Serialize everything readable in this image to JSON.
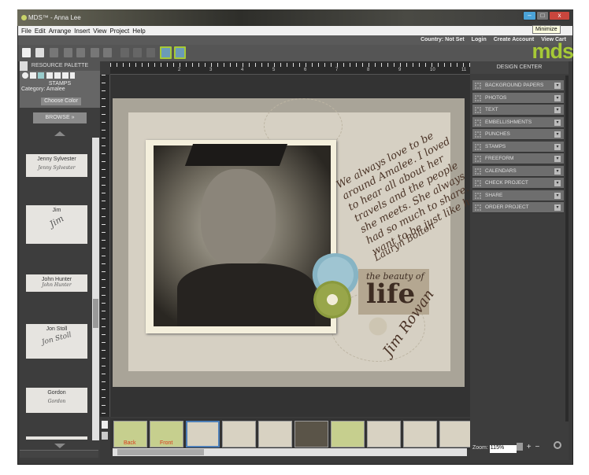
{
  "window": {
    "title": "MDS™ - Anna Lee",
    "tooltip": "Minimize",
    "minimize": "–",
    "maximize": "□",
    "close": "x"
  },
  "menu": [
    "File",
    "Edit",
    "Arrange",
    "Insert",
    "View",
    "Project",
    "Help"
  ],
  "links": [
    "Country: Not Set",
    "Login",
    "Create Account",
    "View Cart"
  ],
  "logo": "mds",
  "left_panel": {
    "title": "RESOURCE PALETTE",
    "section": "STAMPS",
    "category": "Category: Amalee",
    "choose_color": "Choose Color",
    "browse": "BROWSE »",
    "items": [
      {
        "name": "Jenny Sylvester",
        "sig": "Jenny Sylvester"
      },
      {
        "name": "Jim",
        "sig": "Jim"
      },
      {
        "name": "John Hunter",
        "sig": "John Hunter"
      },
      {
        "name": "Jon Stoll",
        "sig": "Jon Stoll"
      },
      {
        "name": "Gordon",
        "sig": "Gordon"
      }
    ]
  },
  "ruler_labels": [
    "2",
    "3",
    "4",
    "5",
    "6",
    "7",
    "8",
    "9",
    "10",
    "11"
  ],
  "page": {
    "journal": "We always love to be around Amalee. I loved to hear all about her travels and the people she meets. She always had so much to share. I want to be just like her.",
    "journal_signature": "Lauryn Bolton",
    "title_small": "the beauty of",
    "title_big": "life",
    "signature": "Jim Rowan"
  },
  "filmstrip": {
    "thumbs": [
      {
        "label": "Back",
        "color": "#c6cf8e"
      },
      {
        "label": "Front",
        "color": "#c6cf8e"
      },
      {
        "label": "",
        "color": "#d8d2c2",
        "selected": true
      },
      {
        "label": "",
        "color": "#d8d2c2"
      },
      {
        "label": "",
        "color": "#d8d2c2"
      },
      {
        "label": "",
        "color": "#5a5448"
      },
      {
        "label": "",
        "color": "#c6cf8e"
      },
      {
        "label": "",
        "color": "#d8d2c2"
      },
      {
        "label": "",
        "color": "#d8d2c2"
      },
      {
        "label": "",
        "color": "#d8d2c2"
      }
    ],
    "label_color": "#d93a1a"
  },
  "right_panel": {
    "title": "DESIGN CENTER",
    "items": [
      "BACKGROUND PAPERS",
      "PHOTOS",
      "TEXT",
      "EMBELLISHMENTS",
      "PUNCHES",
      "STAMPS",
      "FREEFORM",
      "CALENDARS",
      "CHECK PROJECT",
      "SHARE",
      "ORDER PROJECT"
    ]
  },
  "zoom": {
    "label": "Zoom:",
    "value": "115%",
    "plus": "+",
    "minus": "−"
  },
  "colors": {
    "accent": "#a6c936",
    "panel": "#3d3d3d"
  }
}
